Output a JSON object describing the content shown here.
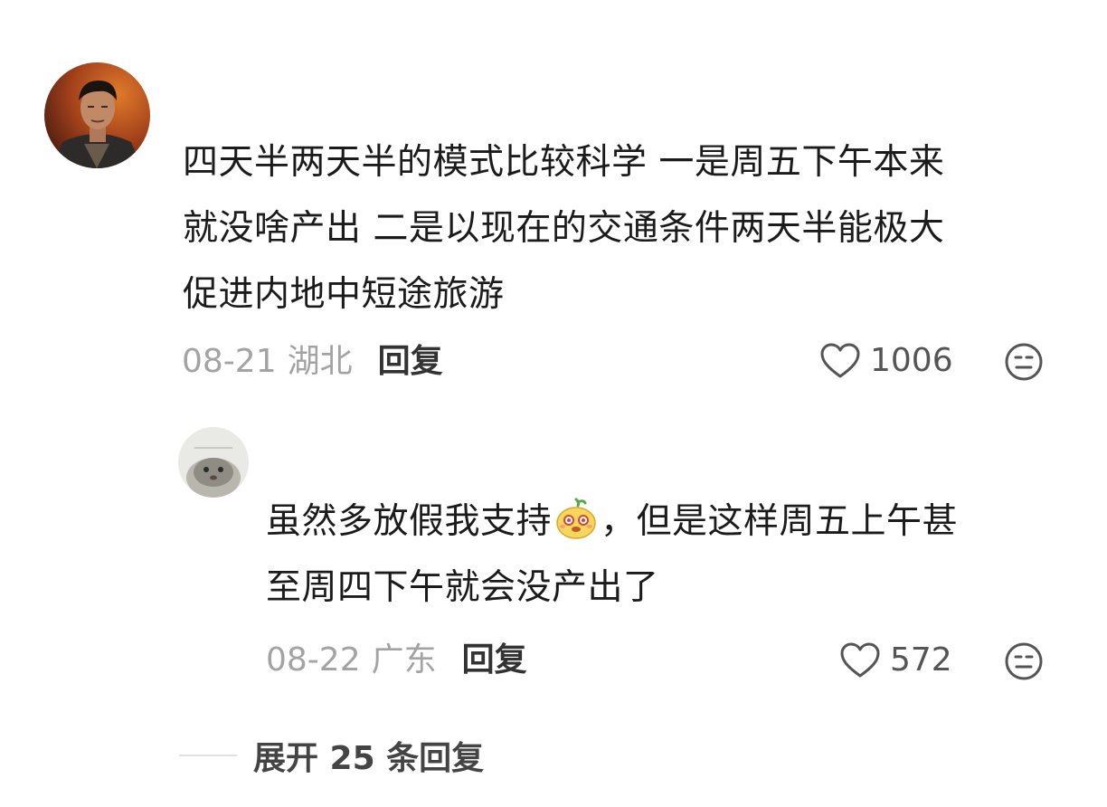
{
  "comment": {
    "text_lines": [
      "四天半两天半的模式比较科学 一是周五下午本来",
      "就没啥产出 二是以现在的交通条件两天半能极大",
      "促进内地中短途旅游"
    ],
    "date": "08-21",
    "location": "湖北",
    "reply_label": "回复",
    "like_count": "1006",
    "avatar_icon": "user-avatar-icon"
  },
  "reply": {
    "text_line1_before": "虽然多放假我支持",
    "text_line1_after": "，但是这样周五上午甚",
    "text_line2": "至周四下午就会没产出了",
    "emoji_icon": "cute-face-emoji-icon",
    "date": "08-22",
    "location": "广东",
    "reply_label": "回复",
    "like_count": "572",
    "avatar_icon": "user-avatar-icon"
  },
  "expand": {
    "label": "展开 25 条回复"
  },
  "colors": {
    "text": "#1b1b1b",
    "meta": "#a3a3a3",
    "reply_button": "#333333",
    "icon": "#555555"
  }
}
